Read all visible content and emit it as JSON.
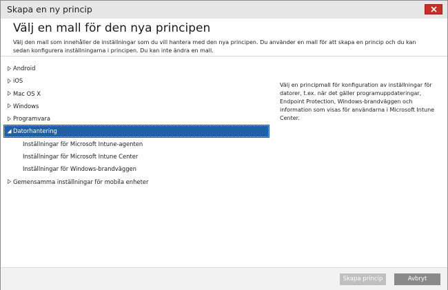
{
  "window": {
    "title": "Skapa en ny princip"
  },
  "header": {
    "heading": "Välj en mall för den nya principen",
    "description": "Välj den mall som innehåller de inställningar som du vill hantera med den nya principen. Du använder en mall för att skapa en princip och du kan sedan konfigurera inställningarna i principen. Du kan inte ändra en mall."
  },
  "tree": {
    "items": [
      {
        "label": "Android",
        "state": "collapsed"
      },
      {
        "label": "iOS",
        "state": "collapsed"
      },
      {
        "label": "Mac OS X",
        "state": "collapsed"
      },
      {
        "label": "Windows",
        "state": "collapsed"
      },
      {
        "label": "Programvara",
        "state": "collapsed"
      },
      {
        "label": "Datorhantering",
        "state": "expanded",
        "selected": true
      },
      {
        "label": "Inställningar för Microsoft Intune-agenten",
        "level": 1
      },
      {
        "label": "Inställningar för Microsoft Intune Center",
        "level": 1
      },
      {
        "label": "Inställningar för Windows-brandväggen",
        "level": 1
      },
      {
        "label": "Gemensamma inställningar för mobila enheter",
        "state": "collapsed"
      }
    ]
  },
  "details": {
    "text": "Välj en principmall för konfiguration av inställningar för datorer, t.ex. när det gäller programuppdateringar, Endpoint Protection, Windows-brandväggen och information som visas för användarna i Microsoft Intune Center."
  },
  "footer": {
    "create_label": "Skapa princip",
    "cancel_label": "Avbryt"
  },
  "colors": {
    "selection": "#1e5fa8",
    "close_button": "#c7302a",
    "create_button_disabled": "#bfbfbf",
    "cancel_button": "#8a8a8a"
  },
  "icons": {
    "collapsed": "triangle-right-icon",
    "expanded": "triangle-down-icon",
    "close": "close-icon"
  }
}
